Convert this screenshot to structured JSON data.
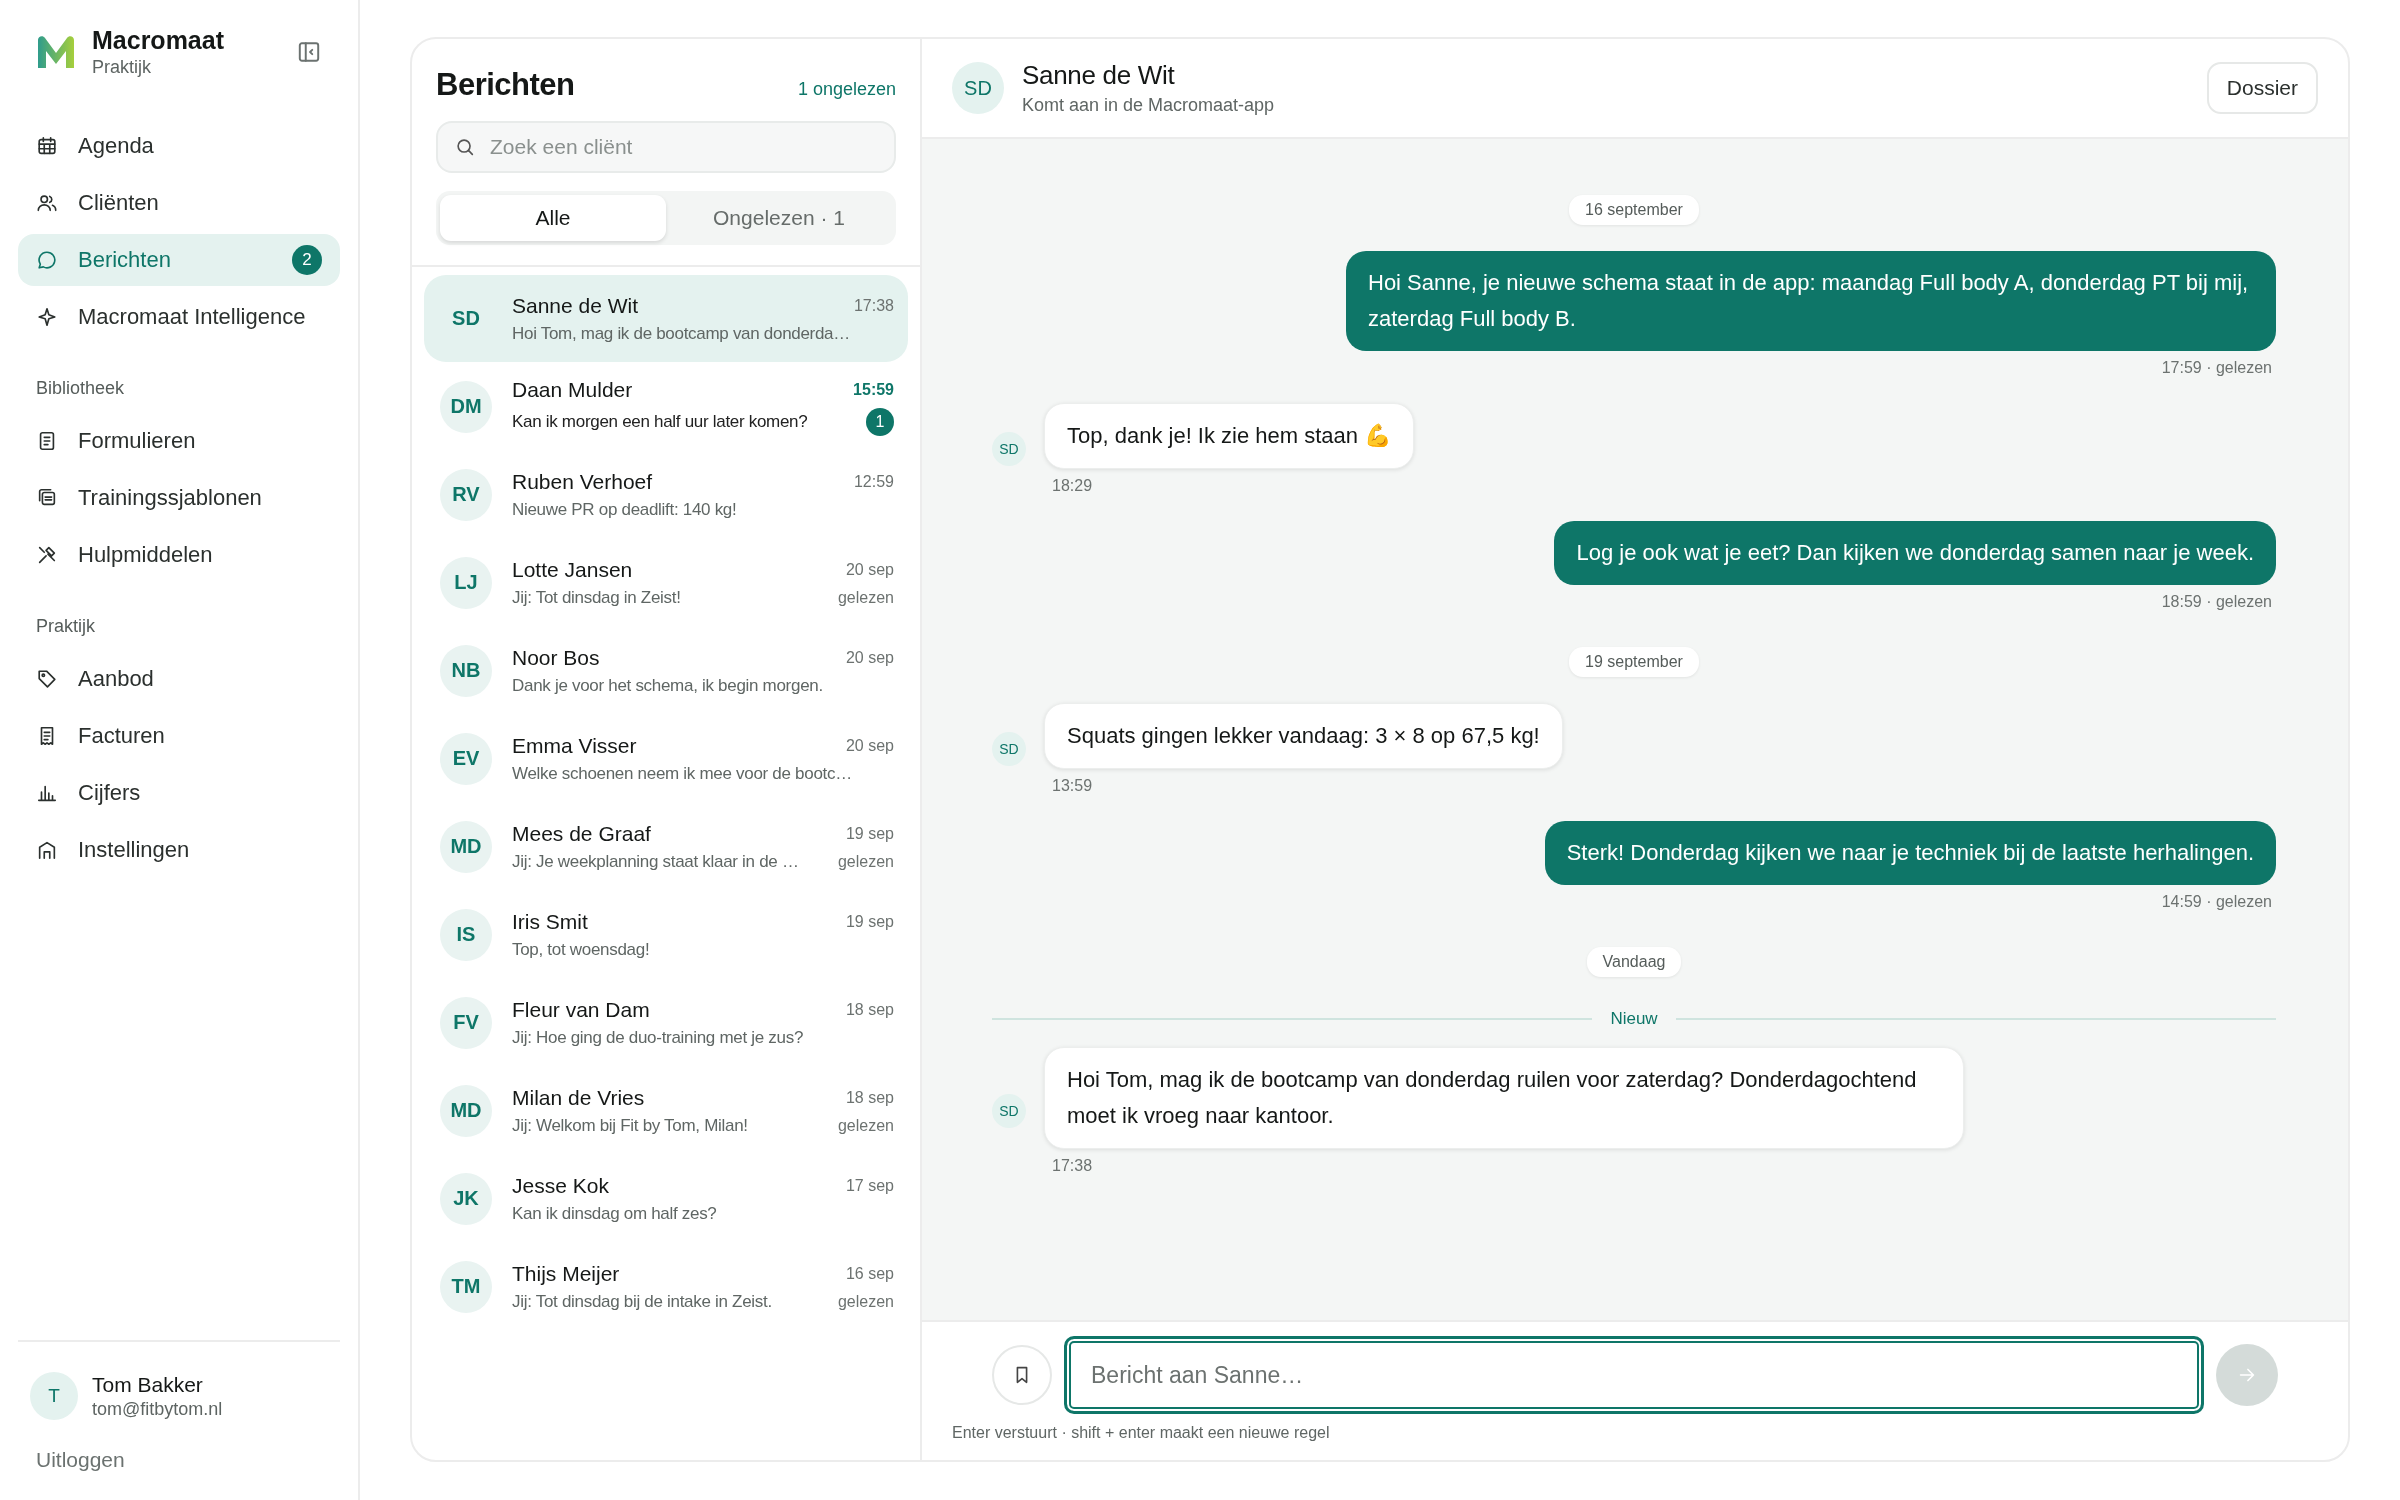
{
  "sidebar": {
    "brand": {
      "name": "Macromaat",
      "subtitle": "Praktijk"
    },
    "sections": [
      {
        "items": [
          {
            "label": "Agenda",
            "kind": "calendar",
            "selected": false
          },
          {
            "label": "Cliënten",
            "kind": "users",
            "selected": false
          },
          {
            "label": "Berichten",
            "kind": "chat",
            "selected": true,
            "badge": "2"
          },
          {
            "label": "Macromaat Intelligence",
            "kind": "sparkle",
            "selected": false
          }
        ]
      },
      {
        "heading": "Bibliotheek",
        "items": [
          {
            "label": "Formulieren",
            "kind": "form",
            "selected": false
          },
          {
            "label": "Trainingssjablonen",
            "kind": "templates",
            "selected": false
          },
          {
            "label": "Hulpmiddelen",
            "kind": "tools",
            "selected": false
          }
        ]
      },
      {
        "heading": "Praktijk",
        "items": [
          {
            "label": "Aanbod",
            "kind": "tag",
            "selected": false
          },
          {
            "label": "Facturen",
            "kind": "invoice",
            "selected": false
          },
          {
            "label": "Cijfers",
            "kind": "chart",
            "selected": false
          },
          {
            "label": "Instellingen",
            "kind": "home",
            "selected": false
          }
        ]
      }
    ],
    "user": {
      "initials": "T",
      "name": "Tom Bakker",
      "email": "tom@fitbytom.nl"
    },
    "logout": "Uitloggen"
  },
  "conversations": {
    "title": "Berichten",
    "unread_summary": "1 ongelezen",
    "search": {
      "placeholder": "Zoek een cliënt"
    },
    "tabs": [
      {
        "label": "Alle",
        "selected": true
      },
      {
        "label": "Ongelezen · 1",
        "selected": false
      }
    ],
    "items": [
      {
        "initials": "SD",
        "name": "Sanne de Wit",
        "time": "17:38",
        "preview": "Hoi Tom, mag ik de bootcamp van donderda…",
        "selected": true,
        "unread": false
      },
      {
        "initials": "DM",
        "name": "Daan Mulder",
        "time": "15:59",
        "preview": "Kan ik morgen een half uur later komen?",
        "selected": false,
        "unread": true,
        "badge": "1"
      },
      {
        "initials": "RV",
        "name": "Ruben Verhoef",
        "time": "12:59",
        "preview": "Nieuwe PR op deadlift: 140 kg!",
        "selected": false,
        "unread": false
      },
      {
        "initials": "LJ",
        "name": "Lotte Jansen",
        "time": "20 sep",
        "preview": "Jij: Tot dinsdag in Zeist!",
        "status": "gelezen",
        "selected": false,
        "unread": false
      },
      {
        "initials": "NB",
        "name": "Noor Bos",
        "time": "20 sep",
        "preview": "Dank je voor het schema, ik begin morgen.",
        "selected": false,
        "unread": false
      },
      {
        "initials": "EV",
        "name": "Emma Visser",
        "time": "20 sep",
        "preview": "Welke schoenen neem ik mee voor de bootc…",
        "selected": false,
        "unread": false
      },
      {
        "initials": "MD",
        "name": "Mees de Graaf",
        "time": "19 sep",
        "preview": "Jij: Je weekplanning staat klaar in de …",
        "status": "gelezen",
        "selected": false,
        "unread": false
      },
      {
        "initials": "IS",
        "name": "Iris Smit",
        "time": "19 sep",
        "preview": "Top, tot woensdag!",
        "selected": false,
        "unread": false
      },
      {
        "initials": "FV",
        "name": "Fleur van Dam",
        "time": "18 sep",
        "preview": "Jij: Hoe ging de duo-training met je zus?",
        "selected": false,
        "unread": false
      },
      {
        "initials": "MD",
        "name": "Milan de Vries",
        "time": "18 sep",
        "preview": "Jij: Welkom bij Fit by Tom, Milan!",
        "status": "gelezen",
        "selected": false,
        "unread": false
      },
      {
        "initials": "JK",
        "name": "Jesse Kok",
        "time": "17 sep",
        "preview": "Kan ik dinsdag om half zes?",
        "selected": false,
        "unread": false
      },
      {
        "initials": "TM",
        "name": "Thijs Meijer",
        "time": "16 sep",
        "preview": "Jij: Tot dinsdag bij de intake in Zeist.",
        "status": "gelezen",
        "selected": false,
        "unread": false
      }
    ]
  },
  "chat": {
    "contact": {
      "initials": "SD",
      "name": "Sanne de Wit",
      "subtitle": "Komt aan in de Macromaat-app"
    },
    "dossier_button": "Dossier",
    "timeline": [
      {
        "kind": "date",
        "label": "16 september"
      },
      {
        "kind": "outgoing",
        "text": "Hoi Sanne, je nieuwe schema staat in de app: maandag Full body A, donderdag PT bij mij, zaterdag Full body B.",
        "meta": "17:59 · gelezen"
      },
      {
        "kind": "incoming",
        "initials": "SD",
        "text": "Top, dank je! Ik zie hem staan 💪",
        "meta": "18:29"
      },
      {
        "kind": "outgoing",
        "text": "Log je ook wat je eet? Dan kijken we donderdag samen naar je week.",
        "meta": "18:59 · gelezen"
      },
      {
        "kind": "date",
        "label": "19 september"
      },
      {
        "kind": "incoming",
        "initials": "SD",
        "text": "Squats gingen lekker vandaag: 3 × 8 op 67,5 kg!",
        "meta": "13:59"
      },
      {
        "kind": "outgoing",
        "text": "Sterk! Donderdag kijken we naar je techniek bij de laatste herhalingen.",
        "meta": "14:59 · gelezen"
      },
      {
        "kind": "date",
        "label": "Vandaag"
      },
      {
        "kind": "divider",
        "label": "Nieuw"
      },
      {
        "kind": "incoming",
        "initials": "SD",
        "text": "Hoi Tom, mag ik de bootcamp van donderdag ruilen voor zaterdag? Donderdagochtend moet ik vroeg naar kantoor.",
        "meta": "17:38"
      }
    ],
    "composer": {
      "placeholder": "Bericht aan Sanne…",
      "hint": "Enter verstuurt · shift + enter maakt een nieuwe regel",
      "send_disabled": true
    }
  }
}
